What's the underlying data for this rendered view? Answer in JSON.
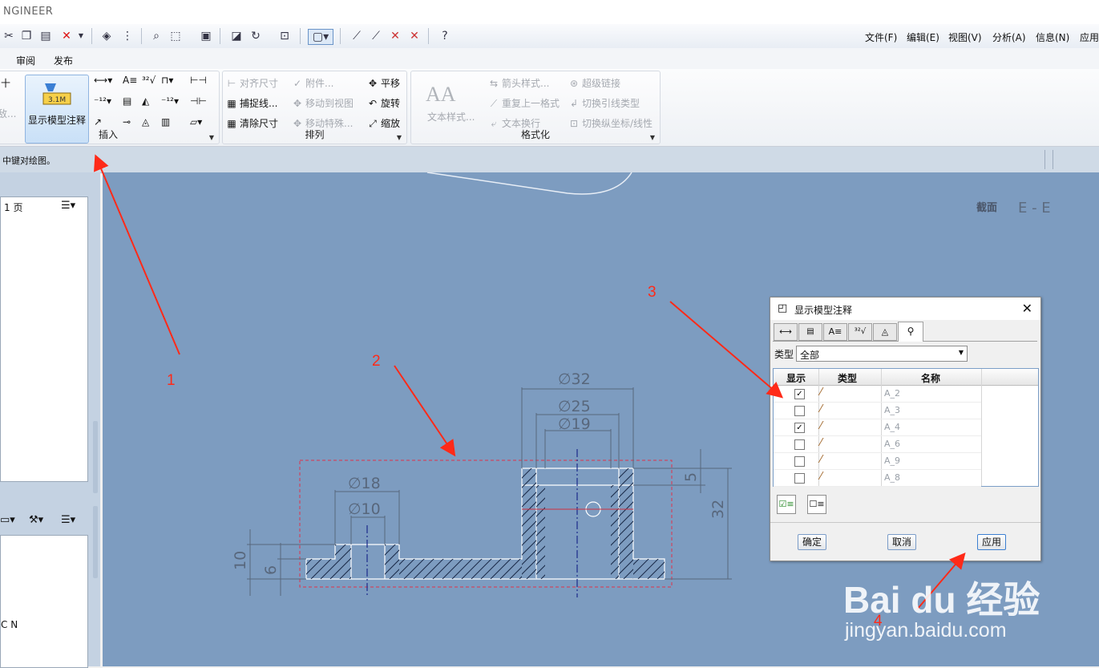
{
  "app": {
    "title": "NGINEER"
  },
  "menu": [
    {
      "label": "文件(F)"
    },
    {
      "label": "编辑(E)"
    },
    {
      "label": "视图(V)"
    },
    {
      "label": "分析(A)"
    },
    {
      "label": "信息(N)"
    },
    {
      "label": "应用"
    }
  ],
  "tabs": [
    {
      "label": "审阅"
    },
    {
      "label": "发布"
    }
  ],
  "ribbon": {
    "insert": {
      "big_button": "显示模型注释",
      "label": "插入",
      "item1": "十",
      "item2": "敌..."
    },
    "arrange": {
      "label": "排列",
      "items": [
        {
          "label": "对齐尺寸",
          "icon": "align-icon",
          "disabled": true
        },
        {
          "label": "捕捉线...",
          "icon": "snap-icon",
          "disabled": false
        },
        {
          "label": "清除尺寸",
          "icon": "clean-icon",
          "disabled": false
        },
        {
          "label": "附件...",
          "icon": "attach-icon",
          "disabled": true
        },
        {
          "label": "移动到视图",
          "icon": "move-view-icon",
          "disabled": true
        },
        {
          "label": "移动特殊...",
          "icon": "move-special-icon",
          "disabled": true
        },
        {
          "label": "平移",
          "icon": "pan-icon",
          "disabled": false
        },
        {
          "label": "旋转",
          "icon": "rotate-icon",
          "disabled": false
        },
        {
          "label": "缩放",
          "icon": "zoom-icon",
          "disabled": false
        }
      ]
    },
    "format": {
      "label": "格式化",
      "text_style": "文本样式...",
      "items": [
        {
          "label": "箭头样式...",
          "icon": "arrow-style-icon"
        },
        {
          "label": "重复上一格式",
          "icon": "repeat-format-icon"
        },
        {
          "label": "文本换行",
          "icon": "text-wrap-icon"
        },
        {
          "label": "超级链接",
          "icon": "hyperlink-icon"
        },
        {
          "label": "切换引线类型",
          "icon": "leader-type-icon"
        },
        {
          "label": "切换纵坐标/线性",
          "icon": "ordinate-icon"
        }
      ]
    }
  },
  "status": {
    "message": "中键对绘图。"
  },
  "left_panel": {
    "page_label": "1 页",
    "tree_text": "C N"
  },
  "drawing": {
    "section_label": "截面",
    "section_name": "E - E",
    "dims": {
      "d32": "∅32",
      "d25": "∅25",
      "d19": "∅19",
      "d18": "∅18",
      "d10": "∅10",
      "h5": "5",
      "h32": "32",
      "h10": "10",
      "h6": "6"
    }
  },
  "dialog": {
    "title": "显示模型注释",
    "type_label": "类型",
    "type_value": "全部",
    "columns": {
      "show": "显示",
      "type": "类型",
      "name": "名称"
    },
    "rows": [
      {
        "name": "A_2",
        "checked": true
      },
      {
        "name": "A_3",
        "checked": false
      },
      {
        "name": "A_4",
        "checked": true
      },
      {
        "name": "A_6",
        "checked": false
      },
      {
        "name": "A_9",
        "checked": false
      },
      {
        "name": "A_8",
        "checked": false
      }
    ],
    "ok": "确定",
    "cancel": "取消",
    "apply": "应用"
  },
  "annotations": {
    "n1": "1",
    "n2": "2",
    "n3": "3",
    "n4": "4"
  },
  "watermark": {
    "brand": "Bai du 经验",
    "url": "jingyan.baidu.com"
  }
}
